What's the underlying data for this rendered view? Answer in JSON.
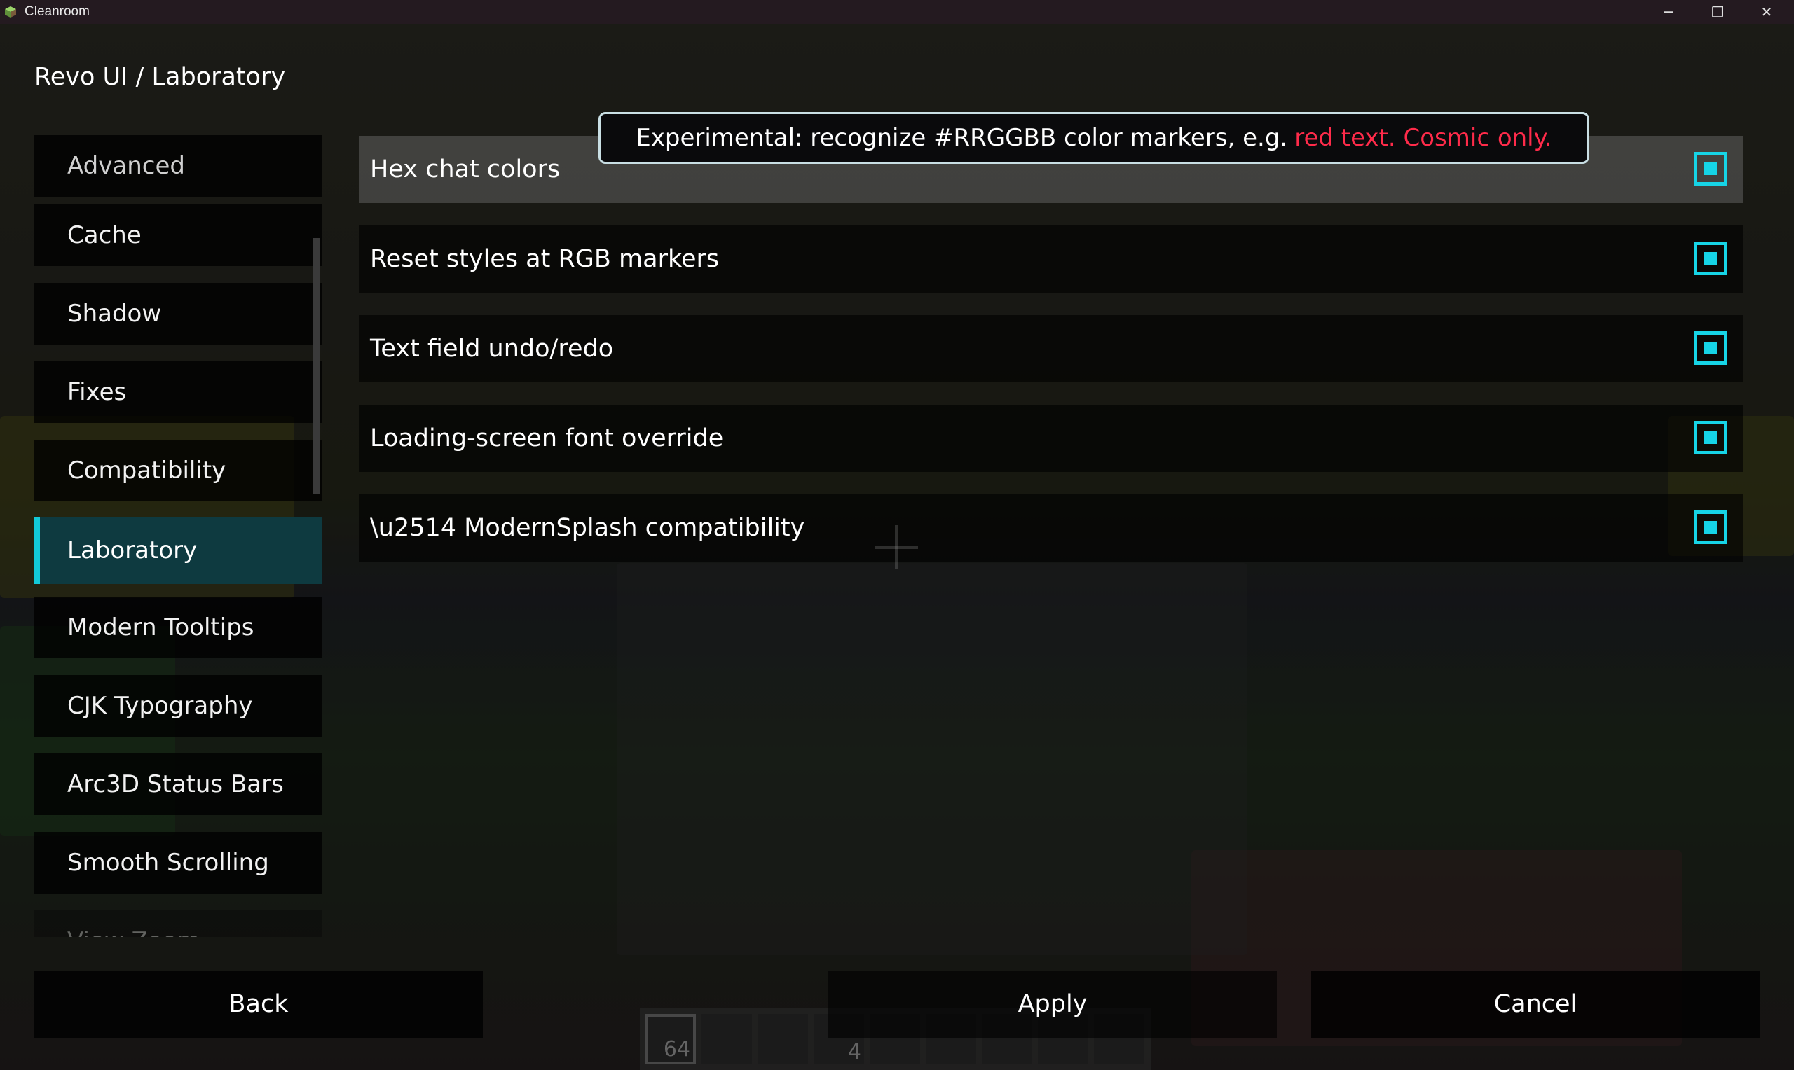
{
  "window": {
    "title": "Cleanroom",
    "minimize_glyph": "─",
    "restore_glyph": "❐",
    "close_glyph": "✕"
  },
  "breadcrumb": "Revo UI / Laboratory",
  "sidebar": {
    "items": [
      {
        "label": "Advanced"
      },
      {
        "label": "Cache"
      },
      {
        "label": "Shadow"
      },
      {
        "label": "Fixes"
      },
      {
        "label": "Compatibility"
      },
      {
        "label": "Laboratory",
        "active": true
      },
      {
        "label": "Modern Tooltips"
      },
      {
        "label": "CJK Typography"
      },
      {
        "label": "Arc3D Status Bars"
      },
      {
        "label": "Smooth Scrolling"
      },
      {
        "label": "View Zoom"
      }
    ]
  },
  "settings": [
    {
      "label": "Hex chat colors",
      "checked": true
    },
    {
      "label": "Reset styles at RGB markers",
      "checked": true
    },
    {
      "label": "Text field undo/redo",
      "checked": true
    },
    {
      "label": "Loading-screen font override",
      "checked": true
    },
    {
      "label": "\\u2514 ModernSplash compatibility",
      "checked": true
    }
  ],
  "tooltip": {
    "text": "Experimental: recognize #RRGGBB color markers, e.g.",
    "highlight": "red text. Cosmic only."
  },
  "buttons": {
    "back": "Back",
    "apply": "Apply",
    "cancel": "Cancel"
  },
  "hotbar": {
    "slot_counts": [
      "64",
      "4"
    ]
  },
  "colors": {
    "accent": "#16d4e6",
    "active_bg": "#0e3a40",
    "highlight_red": "#ff2b4a"
  }
}
